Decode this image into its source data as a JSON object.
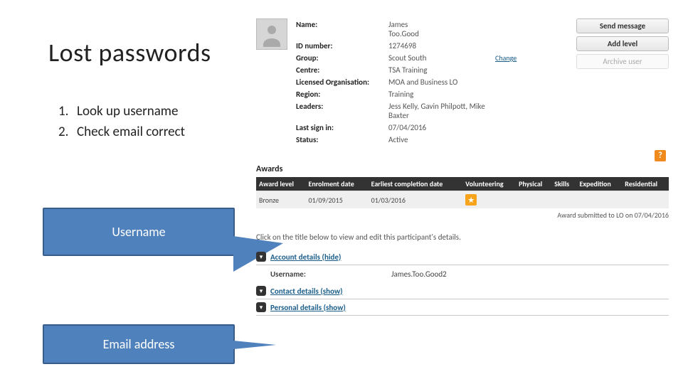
{
  "slide": {
    "title": "Lost passwords",
    "steps": [
      {
        "num": "1.",
        "text": "Look up username"
      },
      {
        "num": "2.",
        "text": "Check email correct"
      }
    ],
    "callout_username": "Username",
    "callout_email": "Email address"
  },
  "profile": {
    "fields": {
      "name_label": "Name:",
      "name_value": "James\nToo.Good",
      "id_label": "ID number:",
      "id_value": "1274698",
      "group_label": "Group:",
      "group_value": "Scout South",
      "group_change": "Change",
      "centre_label": "Centre:",
      "centre_value": "TSA Training",
      "org_label": "Licensed Organisation:",
      "org_value": "MOA and Business LO",
      "region_label": "Region:",
      "region_value": "Training",
      "leaders_label": "Leaders:",
      "leaders_value": "Jess Kelly, Gavin Philpott, Mike Baxter",
      "signin_label": "Last sign in:",
      "signin_value": "07/04/2016",
      "status_label": "Status:",
      "status_value": "Active"
    },
    "actions": {
      "send_message": "Send message",
      "add_level": "Add level",
      "archive_user": "Archive user"
    }
  },
  "awards": {
    "heading": "Awards",
    "help_glyph": "?",
    "columns": [
      "Award level",
      "Enrolment date",
      "Earliest completion date",
      "Volunteering",
      "Physical",
      "Skills",
      "Expedition",
      "Residential"
    ],
    "row": {
      "level": "Bronze",
      "enrolment": "01/09/2015",
      "completion": "01/03/2016"
    },
    "star_glyph": "★",
    "submitted_note": "Award submitted to LO on 07/04/2016"
  },
  "details": {
    "hint": "Click on the title below to view and edit this participant's details.",
    "account_title": "Account details (hide)",
    "username_label": "Username:",
    "username_value": "James.Too.Good2",
    "contact_title": "Contact details (show)",
    "personal_title": "Personal details (show)"
  }
}
